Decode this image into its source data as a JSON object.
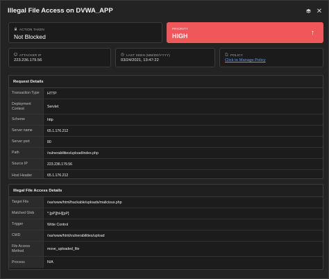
{
  "header": {
    "title": "Illegal File Access on DVWA_APP",
    "icons": [
      "stack-icon",
      "close-icon"
    ]
  },
  "action": {
    "label": "ACTION TAKEN",
    "value": "Not Blocked",
    "icon": "lock-icon"
  },
  "priority": {
    "label": "PRIORITY",
    "value": "HIGH",
    "icon": "arrow-up-icon",
    "color": "#f0575a"
  },
  "attacker": {
    "label": "ATTACKER IP",
    "value": "223.236.179.56",
    "icon": "screen-icon"
  },
  "last_seen": {
    "label": "LAST SEEN (MM/DD/YYYY)",
    "value": "03/24/2021, 13:47:22",
    "icon": "clock-icon"
  },
  "policy": {
    "label": "POLICY",
    "link_text": "Click to Manage Policy",
    "icon": "document-icon",
    "link_color": "#5c9dff"
  },
  "request_details": {
    "title": "Request Details",
    "rows": [
      {
        "key": "Transaction Type",
        "value": "HTTP"
      },
      {
        "key": "Deployment Context",
        "value": "Servlet"
      },
      {
        "key": "Scheme",
        "value": "http"
      },
      {
        "key": "Server name",
        "value": "65.1.176.212"
      },
      {
        "key": "Server port",
        "value": "80"
      },
      {
        "key": "Path",
        "value": "/vulnerabilities/upload/index.php"
      },
      {
        "key": "Source IP",
        "value": "223.236.179.56"
      },
      {
        "key": "Host Header",
        "value": "65.1.176.212"
      }
    ]
  },
  "illegal_file_access": {
    "title": "Illegal File Access Details",
    "rows": [
      {
        "key": "Target File",
        "value": "/var/www/html/hackable/uploads/malicious.php"
      },
      {
        "key": "Matched Glob",
        "value": "*.[pP][hH][pP]"
      },
      {
        "key": "Trigger",
        "value": "Write Control"
      },
      {
        "key": "CWD",
        "value": "/var/www/html/vulnerabilities/upload"
      },
      {
        "key": "File Access Method",
        "value": "move_uploaded_file"
      },
      {
        "key": "Process",
        "value": "N/A"
      }
    ]
  }
}
